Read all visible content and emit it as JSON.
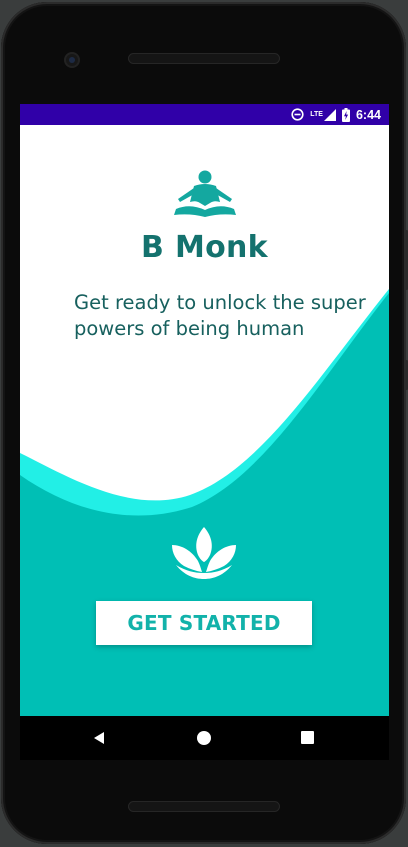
{
  "status_bar": {
    "network": "LTE",
    "time": "6:44"
  },
  "app": {
    "title": "B Monk",
    "tagline": "Get ready to unlock the super powers of being human",
    "cta_label": "GET STARTED",
    "logo_icon": "meditation-icon",
    "footer_icon": "lotus-icon"
  },
  "colors": {
    "status_bar": "#3000a8",
    "teal": "#00bfb5",
    "teal_light": "#22efe6",
    "title": "#14726e",
    "tagline": "#17605e",
    "button_text": "#12b2aa"
  },
  "navigation": {
    "back": "back-icon",
    "home": "home-icon",
    "recents": "recents-icon"
  }
}
